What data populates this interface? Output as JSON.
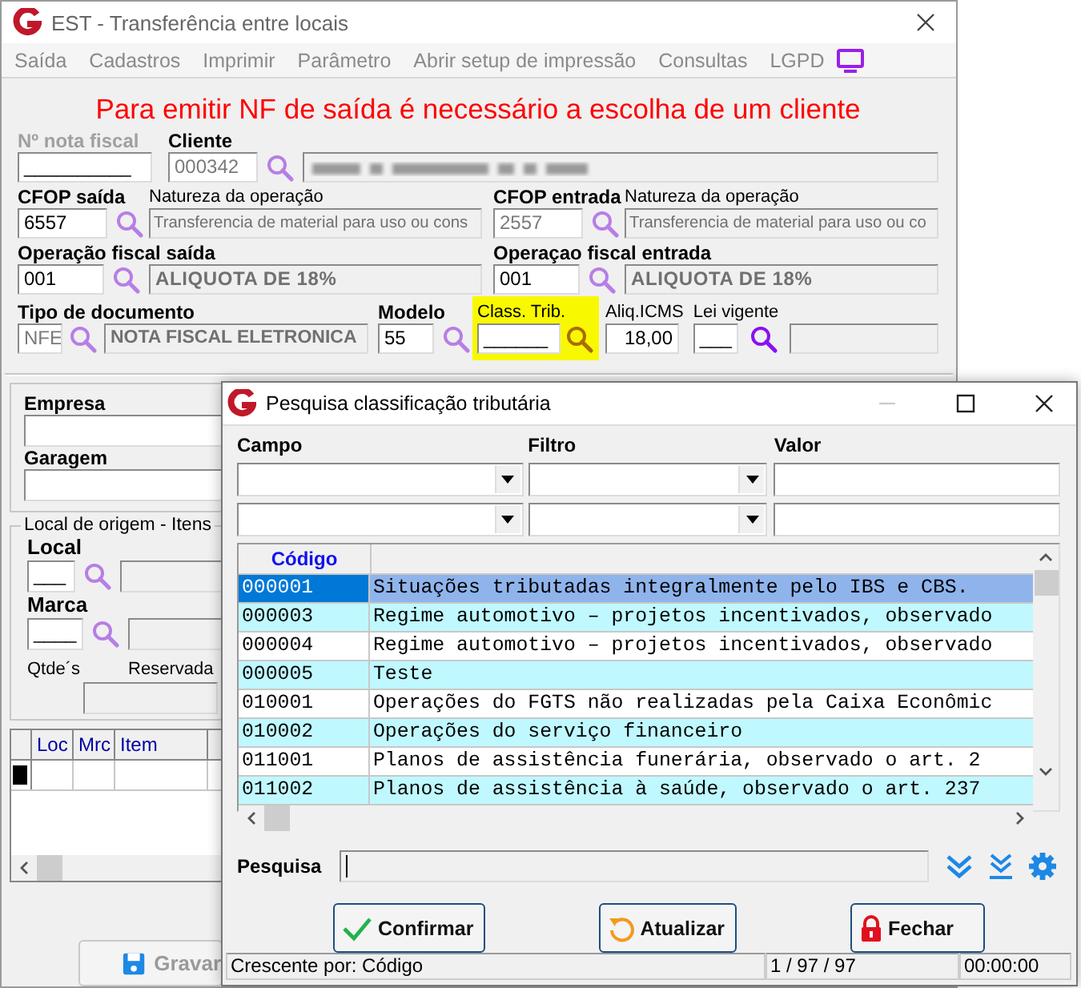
{
  "main_window": {
    "title": "EST - Transferência entre locais",
    "menu": [
      "Saída",
      "Cadastros",
      "Imprimir",
      "Parâmetro",
      "Abrir setup de impressão",
      "Consultas",
      "LGPD"
    ],
    "warning": "Para emitir NF de saída é necessário a escolha de um cliente",
    "nota_fiscal": {
      "label": "Nº nota fiscal",
      "value": "__________",
      "disabled": true
    },
    "cliente": {
      "label": "Cliente",
      "code": "000342"
    },
    "cfop_saida": {
      "label": "CFOP saída",
      "code": "6557",
      "natureza_label": "Natureza da operação",
      "natureza": "Transferencia de material para uso ou cons"
    },
    "cfop_entrada": {
      "label": "CFOP entrada",
      "code": "2557",
      "natureza_label": "Natureza da operação",
      "natureza": "Transferencia de material para uso ou co"
    },
    "operacao_saida": {
      "label": "Operação fiscal saída",
      "code": "001",
      "description": "ALIQUOTA DE 18%"
    },
    "operacao_entrada": {
      "label": "Operaçao fiscal entrada",
      "code": "001",
      "description": "ALIQUOTA DE 18%"
    },
    "tipo_documento": {
      "label": "Tipo de documento",
      "code": "NFE",
      "description": "NOTA FISCAL ELETRONICA"
    },
    "modelo": {
      "label": "Modelo",
      "value": "55"
    },
    "class_trib": {
      "label": "Class. Trib.",
      "value": "______",
      "highlighted": true
    },
    "aliq_icms": {
      "label": "Aliq.ICMS",
      "value": "18,00"
    },
    "lei_vigente": {
      "label": "Lei vigente",
      "value": "___"
    },
    "empresa": {
      "label": "Empresa"
    },
    "garagem": {
      "label": "Garagem"
    },
    "local_origem": {
      "title": "Local de origem - Itens",
      "local": {
        "label": "Local",
        "value": "___"
      },
      "marca": {
        "label": "Marca",
        "value": "____"
      },
      "qtdes_label": "Qtde´s",
      "reservada_label": "Reservada"
    },
    "items_grid": {
      "columns": [
        "Loc",
        "Mrc",
        "Item"
      ]
    },
    "save_button": {
      "label": "Gravar",
      "disabled": true
    }
  },
  "dialog": {
    "title": "Pesquisa classificação tributária",
    "filter_labels": [
      "Campo",
      "Filtro",
      "Valor"
    ],
    "columns": [
      "Código"
    ],
    "rows": [
      {
        "code": "000001",
        "description": "Situações tributadas integralmente pelo IBS e CBS.",
        "selected": true
      },
      {
        "code": "000003",
        "description": "Regime automotivo – projetos incentivados, observado",
        "selected": false
      },
      {
        "code": "000004",
        "description": "Regime automotivo – projetos incentivados, observado",
        "selected": false
      },
      {
        "code": "000005",
        "description": "Teste",
        "selected": false
      },
      {
        "code": "010001",
        "description": "Operações do FGTS não realizadas pela Caixa Econômic",
        "selected": false
      },
      {
        "code": "010002",
        "description": "Operações do serviço financeiro",
        "selected": false
      },
      {
        "code": "011001",
        "description": "Planos de assistência funerária, observado o art. 2",
        "selected": false
      },
      {
        "code": "011002",
        "description": "Planos de assistência à saúde, observado o art. 237",
        "selected": false
      }
    ],
    "search_label": "Pesquisa",
    "buttons": [
      {
        "kind": "confirm",
        "label": "Confirmar"
      },
      {
        "kind": "refresh",
        "label": "Atualizar"
      },
      {
        "kind": "close",
        "label": "Fechar"
      }
    ],
    "status_bar": [
      "Crescente por: Código",
      "1 / 97 / 97",
      "00:00:00"
    ]
  }
}
